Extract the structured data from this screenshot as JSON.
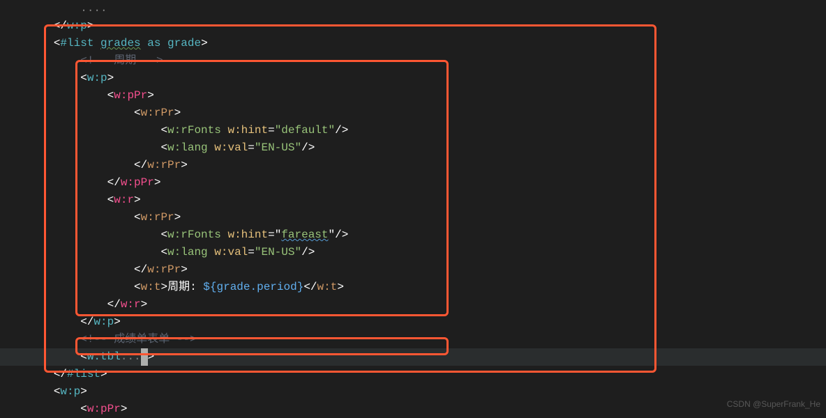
{
  "lines": {
    "l1_partial": "    ....",
    "l2": "</",
    "l2_tag": "w:p",
    "l2_close": ">",
    "l3_open": "<#list ",
    "l3_var": "grades",
    "l3_as": " as ",
    "l3_item": "grade",
    "l3_close": ">",
    "l4_comment": "<!-- 周期 -->",
    "l5_open": "<",
    "l5_tag": "w:p",
    "l5_close": ">",
    "l6_open": "<",
    "l6_tag": "w:pPr",
    "l6_close": ">",
    "l7_open": "<",
    "l7_tag": "w:rPr",
    "l7_close": ">",
    "l8_open": "<",
    "l8_tag": "w:rFonts",
    "l8_attr": " w:hint",
    "l8_eq": "=",
    "l8_val": "\"default\"",
    "l8_close": "/>",
    "l9_open": "<",
    "l9_tag": "w:lang",
    "l9_attr": " w:val",
    "l9_eq": "=",
    "l9_val": "\"EN-US\"",
    "l9_close": "/>",
    "l10_open": "</",
    "l10_tag": "w:rPr",
    "l10_close": ">",
    "l11_open": "</",
    "l11_tag": "w:pPr",
    "l11_close": ">",
    "l12_open": "<",
    "l12_tag": "w:r",
    "l12_close": ">",
    "l13_open": "<",
    "l13_tag": "w:rPr",
    "l13_close": ">",
    "l14_open": "<",
    "l14_tag": "w:rFonts",
    "l14_attr": " w:hint",
    "l14_eq": "=",
    "l14_val": "\"fareast\"",
    "l14_close": "/>",
    "l15_open": "<",
    "l15_tag": "w:lang",
    "l15_attr": " w:val",
    "l15_eq": "=",
    "l15_val": "\"EN-US\"",
    "l15_close": "/>",
    "l16_open": "</",
    "l16_tag": "w:rPr",
    "l16_close": ">",
    "l17_open": "<",
    "l17_tag": "w:t",
    "l17_close1": ">",
    "l17_text": "周期: ",
    "l17_dollar": "${",
    "l17_expr": "grade.period",
    "l17_dollar2": "}",
    "l17_close2": "</",
    "l17_tag2": "w:t",
    "l17_close3": ">",
    "l18_open": "</",
    "l18_tag": "w:r",
    "l18_close": ">",
    "l19_open": "</",
    "l19_tag": "w:p",
    "l19_close": ">",
    "l20_comment": "<!-- 成绩单表单 -->",
    "l21_open": "<",
    "l21_tag": "w:tbl",
    "l21_dots": "...",
    "l21_close": ">",
    "l22_open": "</#",
    "l22_tag": "list",
    "l22_close": ">",
    "l23_open": "<",
    "l23_tag": "w:p",
    "l23_close": ">",
    "l24_open": "<",
    "l24_tag": "w:pPr",
    "l24_close": ">"
  },
  "watermark": "CSDN @SuperFrank_He"
}
